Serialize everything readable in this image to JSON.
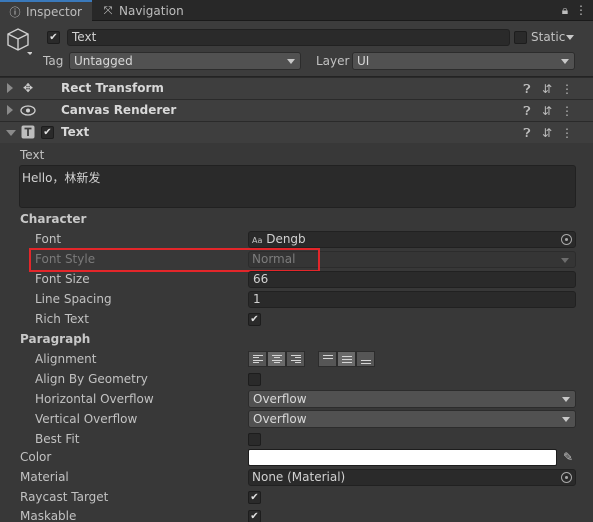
{
  "tabs": {
    "inspector": "Inspector",
    "navigation": "Navigation"
  },
  "header": {
    "object_name": "Text",
    "static_label": "Static",
    "tag_label": "Tag",
    "tag_value": "Untagged",
    "layer_label": "Layer",
    "layer_value": "UI"
  },
  "components": {
    "rect_transform": "Rect Transform",
    "canvas_renderer": "Canvas Renderer",
    "text": "Text"
  },
  "text_component": {
    "text_label": "Text",
    "text_value": "Hello，林新发",
    "character_section": "Character",
    "font_label": "Font",
    "font_value": "Dengb",
    "font_icon_text": "Aa",
    "font_style_label": "Font Style",
    "font_style_value": "Normal",
    "font_size_label": "Font Size",
    "font_size_value": "66",
    "line_spacing_label": "Line Spacing",
    "line_spacing_value": "1",
    "rich_text_label": "Rich Text",
    "rich_text_checked": true,
    "paragraph_section": "Paragraph",
    "alignment_label": "Alignment",
    "align_by_geometry_label": "Align By Geometry",
    "align_by_geometry_checked": false,
    "horizontal_overflow_label": "Horizontal Overflow",
    "horizontal_overflow_value": "Overflow",
    "vertical_overflow_label": "Vertical Overflow",
    "vertical_overflow_value": "Overflow",
    "best_fit_label": "Best Fit",
    "best_fit_checked": false
  },
  "graphic": {
    "color_label": "Color",
    "color_value": "#ffffff",
    "material_label": "Material",
    "material_value": "None (Material)",
    "raycast_target_label": "Raycast Target",
    "raycast_target_checked": true,
    "maskable_label": "Maskable",
    "maskable_checked": true
  },
  "colors": {
    "background": "#383838",
    "highlight_box": "#e3262a",
    "tab_accent": "#3a79bb"
  }
}
